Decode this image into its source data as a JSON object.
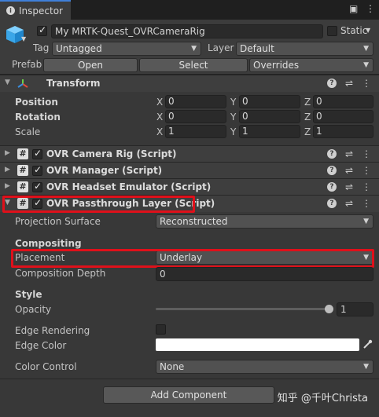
{
  "tabbar": {
    "tab_label": "Inspector",
    "lock_glyph": "🔒",
    "menu_glyph": "⋮"
  },
  "object": {
    "name": "My MRTK-Quest_OVRCameraRig",
    "static_label": "Static",
    "tag_label": "Tag",
    "tag_value": "Untagged",
    "layer_label": "Layer",
    "layer_value": "Default",
    "prefab_label": "Prefab",
    "open_label": "Open",
    "select_label": "Select",
    "overrides_label": "Overrides"
  },
  "transform": {
    "title": "Transform",
    "rows": [
      {
        "label": "Position",
        "x": "0",
        "y": "0",
        "z": "0"
      },
      {
        "label": "Rotation",
        "x": "0",
        "y": "0",
        "z": "0"
      },
      {
        "label": "Scale",
        "x": "1",
        "y": "1",
        "z": "1"
      }
    ],
    "axis_x": "X",
    "axis_y": "Y",
    "axis_z": "Z"
  },
  "components": [
    {
      "name": "OVR Camera Rig (Script)"
    },
    {
      "name": "OVR Manager (Script)"
    },
    {
      "name": "OVR Headset Emulator (Script)"
    },
    {
      "name": "OVR Passthrough Layer (Script)"
    }
  ],
  "passthrough": {
    "projection_surface_label": "Projection Surface",
    "projection_surface_value": "Reconstructed",
    "compositing_header": "Compositing",
    "placement_label": "Placement",
    "placement_value": "Underlay",
    "composition_depth_label": "Composition Depth",
    "composition_depth_value": "0",
    "style_header": "Style",
    "opacity_label": "Opacity",
    "opacity_value": "1",
    "opacity_fraction": 1,
    "edge_rendering_label": "Edge Rendering",
    "edge_color_label": "Edge Color",
    "edge_color_hex": "#ffffff",
    "color_control_label": "Color Control",
    "color_control_value": "None"
  },
  "add_component_label": "Add Component",
  "watermark": "知乎 @千叶Christa",
  "colors": {
    "highlight": "#e0101a",
    "background": "#383838",
    "accent": "#3f7fd9"
  }
}
